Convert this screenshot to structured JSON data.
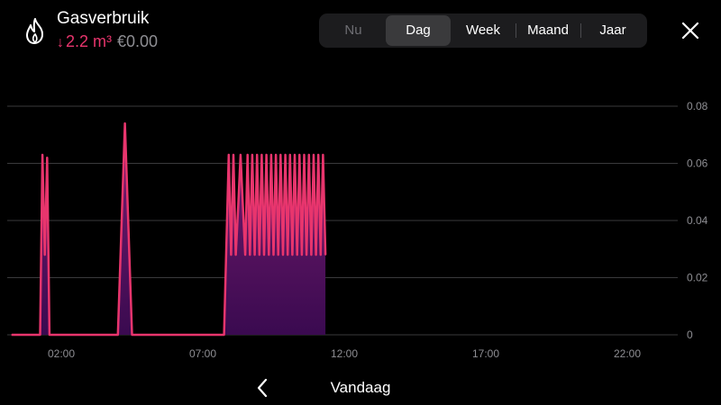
{
  "header": {
    "icon": "flame-icon",
    "title": "Gasverbruik",
    "usage_arrow": "↓",
    "usage_value": "2.2 m³",
    "cost": "€0.00"
  },
  "tabs": [
    {
      "label": "Nu",
      "state": "disabled"
    },
    {
      "label": "Dag",
      "state": "selected"
    },
    {
      "label": "Week",
      "state": "normal"
    },
    {
      "label": "Maand",
      "state": "normal"
    },
    {
      "label": "Jaar",
      "state": "normal"
    }
  ],
  "close_icon": "close-icon",
  "colors": {
    "accent": "#e8356d",
    "fill_top": "#7a1d70",
    "fill_bottom": "#3a0a50",
    "background": "#000000",
    "muted": "#8e8e93"
  },
  "chart_data": {
    "type": "area",
    "xlabel": "",
    "ylabel": "",
    "unit": "m³",
    "x_ticks": [
      "02:00",
      "07:00",
      "12:00",
      "17:00",
      "22:00"
    ],
    "y_ticks": [
      "0",
      "0.02",
      "0.04",
      "0.06",
      "0.08"
    ],
    "ylim": [
      0,
      0.08
    ],
    "grid": true,
    "y_axis_side": "right",
    "series": [
      {
        "points": [
          [
            "00:15",
            0
          ],
          [
            "01:15",
            0
          ],
          [
            "01:20",
            0.063
          ],
          [
            "01:25",
            0.028
          ],
          [
            "01:30",
            0.062
          ],
          [
            "01:35",
            0
          ],
          [
            "04:00",
            0
          ],
          [
            "04:15",
            0.074
          ],
          [
            "04:30",
            0
          ],
          [
            "07:45",
            0
          ],
          [
            "07:55",
            0.063
          ],
          [
            "08:00",
            0.028
          ],
          [
            "08:05",
            0.063
          ],
          [
            "08:10",
            0.028
          ],
          [
            "08:15",
            0.045
          ],
          [
            "08:20",
            0.063
          ],
          [
            "08:25",
            0.045
          ],
          [
            "08:30",
            0.028
          ],
          [
            "08:35",
            0.063
          ],
          [
            "08:40",
            0.028
          ],
          [
            "08:45",
            0.063
          ],
          [
            "08:50",
            0.028
          ],
          [
            "08:55",
            0.063
          ],
          [
            "09:00",
            0.028
          ],
          [
            "09:05",
            0.063
          ],
          [
            "09:10",
            0.028
          ],
          [
            "09:15",
            0.063
          ],
          [
            "09:20",
            0.028
          ],
          [
            "09:25",
            0.063
          ],
          [
            "09:30",
            0.028
          ],
          [
            "09:35",
            0.063
          ],
          [
            "09:40",
            0.028
          ],
          [
            "09:45",
            0.063
          ],
          [
            "09:50",
            0.028
          ],
          [
            "09:55",
            0.063
          ],
          [
            "10:00",
            0.028
          ],
          [
            "10:05",
            0.063
          ],
          [
            "10:10",
            0.028
          ],
          [
            "10:15",
            0.063
          ],
          [
            "10:20",
            0.028
          ],
          [
            "10:25",
            0.063
          ],
          [
            "10:30",
            0.028
          ],
          [
            "10:35",
            0.063
          ],
          [
            "10:40",
            0.028
          ],
          [
            "10:45",
            0.063
          ],
          [
            "10:50",
            0.028
          ],
          [
            "10:55",
            0.063
          ],
          [
            "11:00",
            0.028
          ],
          [
            "11:05",
            0.063
          ],
          [
            "11:10",
            0.028
          ],
          [
            "11:15",
            0.063
          ],
          [
            "11:20",
            0.028
          ]
        ]
      }
    ]
  },
  "footer": {
    "prev_icon": "chevron-left-icon",
    "date_label": "Vandaag"
  }
}
